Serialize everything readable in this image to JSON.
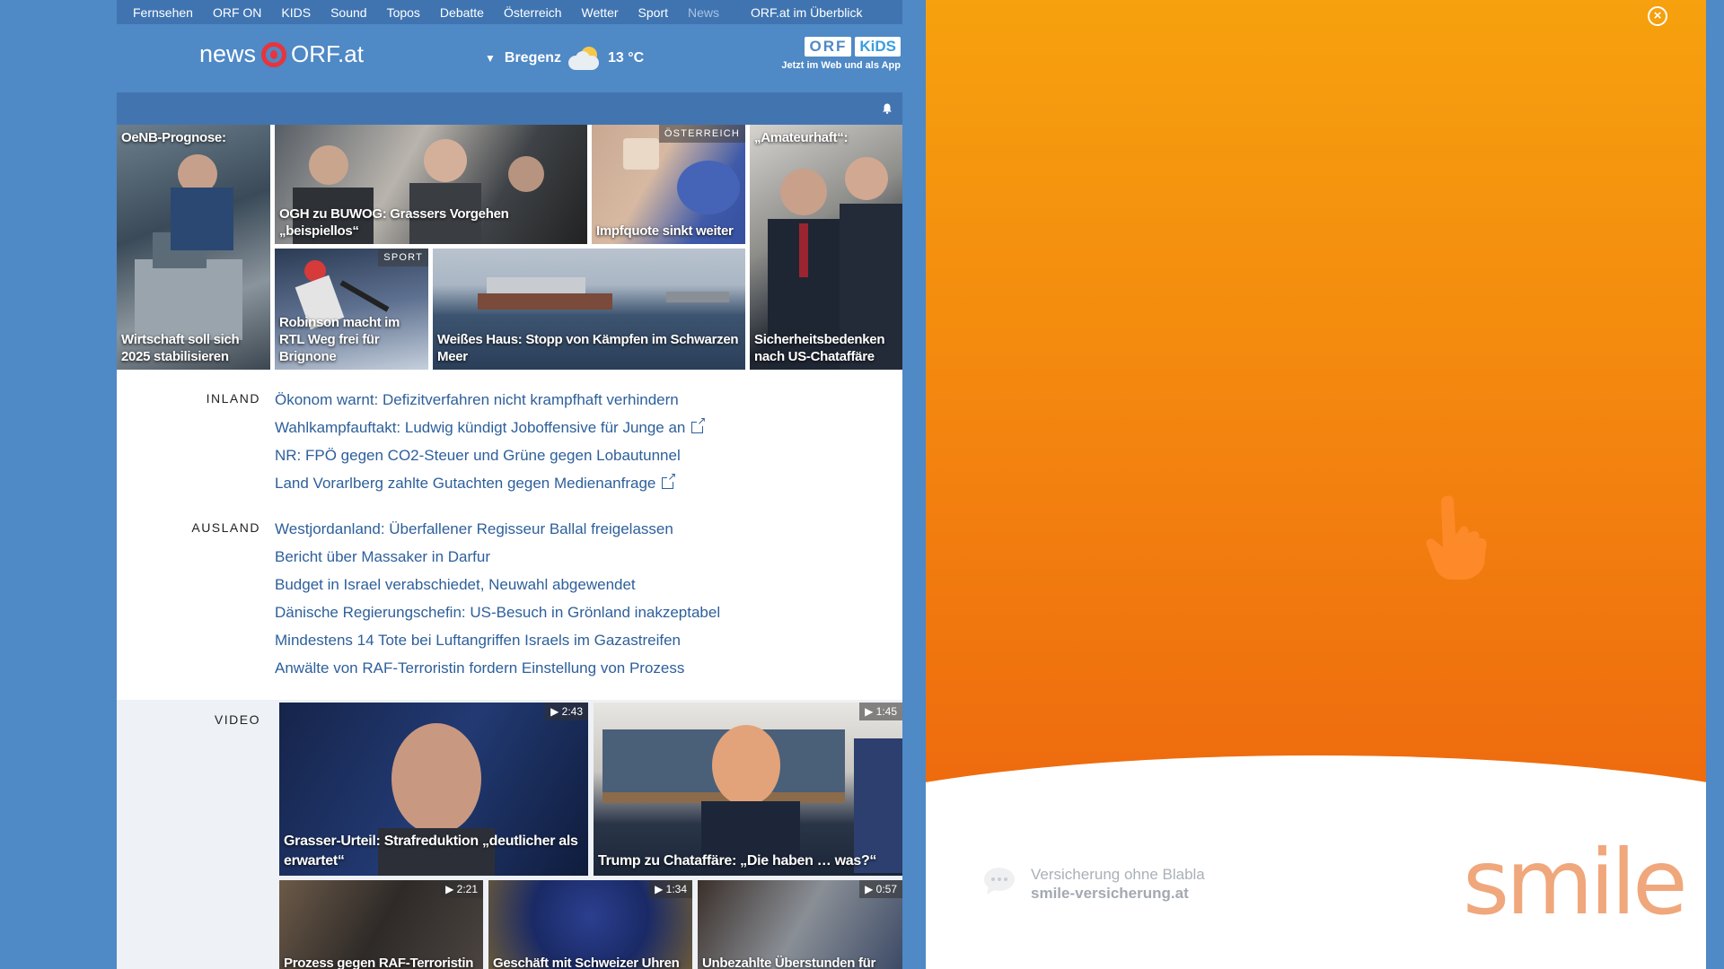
{
  "topnav": {
    "items": [
      "Fernsehen",
      "ORF ON",
      "KIDS",
      "Sound",
      "Topos",
      "Debatte",
      "Österreich",
      "Wetter",
      "Sport",
      "News"
    ],
    "overview": "ORF.at im Überblick"
  },
  "header": {
    "logo_news": "news",
    "logo_orf": "ORF.at",
    "weather_location": "Bregenz",
    "weather_temp": "13 °C",
    "kids_orf": "ORF",
    "kids_kids": "KiDS",
    "kids_sub": "Jetzt im Web und als App"
  },
  "tiles": [
    {
      "top": "OeNB-Prognose:",
      "caption": "Wirtschaft soll sich 2025 stabilisieren"
    },
    {
      "caption": "OGH zu BUWOG: Grassers Vorgehen „beispiellos“"
    },
    {
      "tag": "ÖSTERREICH",
      "caption": "Impfquote sinkt weiter"
    },
    {
      "top": "„Amateurhaft“:",
      "caption": "Sicherheitsbedenken nach US-Chataffäre"
    },
    {
      "tag": "SPORT",
      "caption": "Robinson macht im RTL Weg frei für Brignone"
    },
    {
      "caption": "Weißes Haus: Stopp von Kämpfen im Schwarzen Meer"
    }
  ],
  "inland": {
    "label": "INLAND",
    "items": [
      "Ökonom warnt: Defizitverfahren nicht krampfhaft verhindern",
      "Wahlkampfauftakt: Ludwig kündigt Joboffensive für Junge an",
      "NR: FPÖ gegen CO2-Steuer und Grüne gegen Lobautunnel",
      "Land Vorarlberg zahlte Gutachten gegen Medienanfrage"
    ]
  },
  "ausland": {
    "label": "AUSLAND",
    "items": [
      "Westjordanland: Überfallener Regisseur Ballal freigelassen",
      "Bericht über Massaker in Darfur",
      "Budget in Israel verabschiedet, Neuwahl abgewendet",
      "Dänische Regierungschefin: US-Besuch in Grönland inakzeptabel",
      "Mindestens 14 Tote bei Luftangriffen Israels im Gazastreifen",
      "Anwälte von RAF-Terroristin fordern Einstellung von Prozess"
    ]
  },
  "video": {
    "label": "VIDEO",
    "items": [
      {
        "dur": "2:43",
        "caption": "Grasser-Urteil: Strafreduktion „deutlicher als erwartet“"
      },
      {
        "dur": "1:45",
        "caption": "Trump zu Chataffäre: „Die haben … was?“"
      },
      {
        "dur": "2:21",
        "caption": "Prozess gegen RAF-Terroristin"
      },
      {
        "dur": "1:34",
        "caption": "Geschäft mit Schweizer Uhren"
      },
      {
        "dur": "0:57",
        "caption": "Unbezahlte Überstunden für"
      }
    ]
  },
  "ad": {
    "close": "×",
    "slogan_line1": "Versicherung ohne Blabla",
    "slogan_line2": "smile-versicherung.at",
    "brand": "smile"
  },
  "colors": {
    "page_bg": "#4f89c6",
    "link": "#2d5f9b",
    "ad_orange": "#f3840f",
    "logo_red": "#e8343a"
  }
}
